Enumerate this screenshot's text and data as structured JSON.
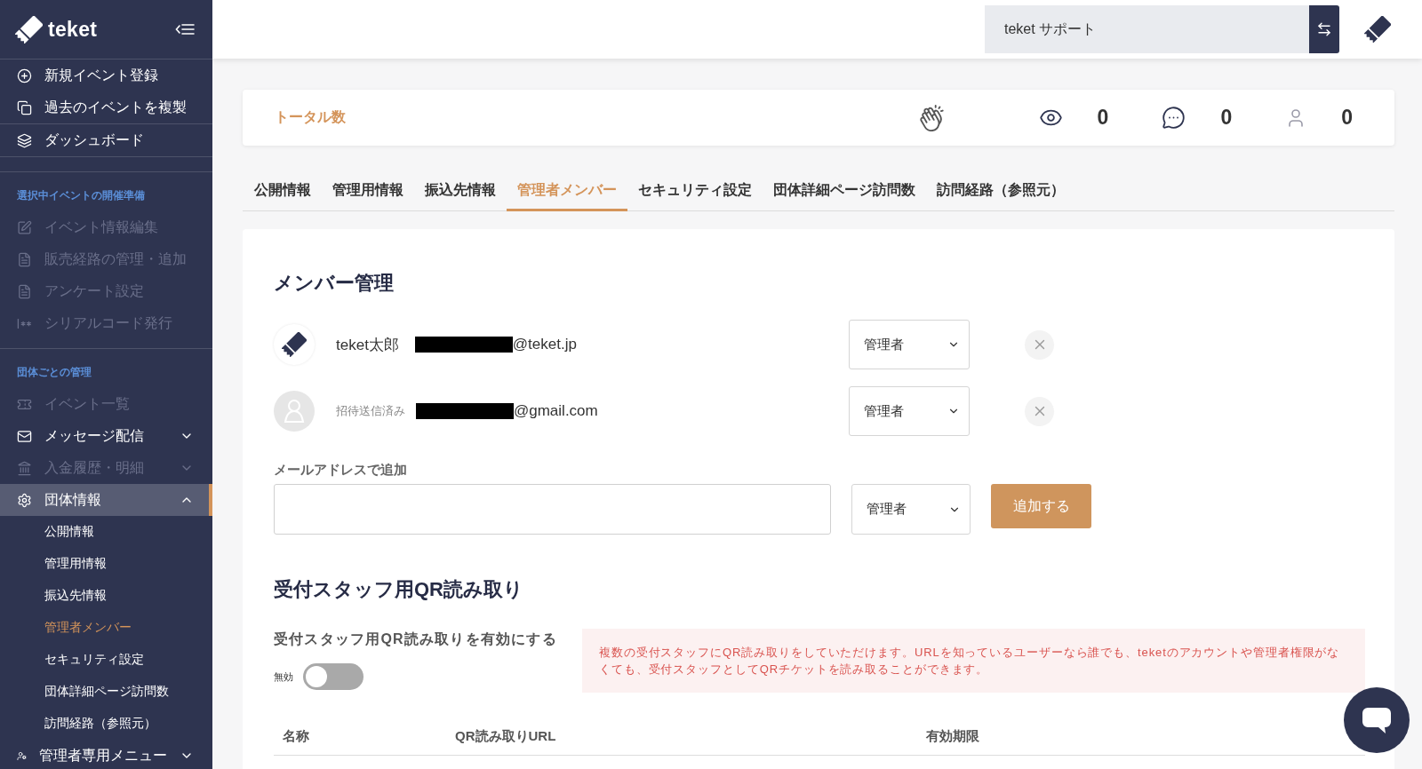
{
  "sidebar": {
    "brand": "teket",
    "groups": [
      {
        "items": [
          {
            "kind": "link",
            "label": "新規イベント登録",
            "selected": false,
            "disabled": false
          },
          {
            "kind": "link",
            "label": "過去のイベントを複製",
            "selected": false,
            "disabled": false
          }
        ]
      },
      {
        "items": [
          {
            "kind": "link",
            "label": "ダッシュボード",
            "selected": false,
            "disabled": false
          }
        ]
      },
      {
        "heading": "選択中イベントの開催準備",
        "items": [
          {
            "kind": "link",
            "label": "イベント情報編集",
            "selected": false,
            "disabled": true
          },
          {
            "kind": "link",
            "label": "販売経路の管理・追加",
            "selected": false,
            "disabled": true
          },
          {
            "kind": "link",
            "label": "アンケート設定",
            "selected": false,
            "disabled": true
          },
          {
            "kind": "link",
            "label": "シリアルコード発行",
            "selected": false,
            "disabled": true
          }
        ]
      },
      {
        "heading": "団体ごとの管理",
        "items": [
          {
            "kind": "link",
            "label": "イベント一覧",
            "selected": false,
            "disabled": true
          },
          {
            "kind": "menu",
            "label": "メッセージ配信",
            "selected": false,
            "disabled": false,
            "expanded": false
          },
          {
            "kind": "menu",
            "label": "入金履歴・明細",
            "selected": false,
            "disabled": true,
            "expanded": false
          },
          {
            "kind": "menu",
            "label": "団体情報",
            "selected": true,
            "disabled": false,
            "expanded": true,
            "children": [
              {
                "label": "公開情報",
                "selected": false
              },
              {
                "label": "管理用情報",
                "selected": false
              },
              {
                "label": "振込先情報",
                "selected": false
              },
              {
                "label": "管理者メンバー",
                "selected": true
              },
              {
                "label": "セキュリティ設定",
                "selected": false
              },
              {
                "label": "団体詳細ページ訪問数",
                "selected": false
              },
              {
                "label": "訪問経路（参照元）",
                "selected": false
              }
            ]
          },
          {
            "kind": "menu",
            "label": "管理者専用メニュー",
            "selected": false,
            "disabled": false,
            "expanded": false
          }
        ]
      }
    ]
  },
  "header": {
    "account": "teket サポート"
  },
  "totals": {
    "title": "トータル数",
    "stats": [
      {
        "value": "0"
      },
      {
        "value": "0"
      },
      {
        "value": "0"
      }
    ]
  },
  "tabs": [
    {
      "label": "公開情報",
      "selected": false
    },
    {
      "label": "管理用情報",
      "selected": false
    },
    {
      "label": "振込先情報",
      "selected": false
    },
    {
      "label": "管理者メンバー",
      "selected": true
    },
    {
      "label": "セキュリティ設定",
      "selected": false
    },
    {
      "label": "団体詳細ページ訪問数",
      "selected": false
    },
    {
      "label": "訪問経路（参照元）",
      "selected": false
    }
  ],
  "members": {
    "title": "メンバー管理",
    "rows": [
      {
        "kind": "account",
        "name": "teket太郎",
        "email_redacted": true,
        "email": "@teket.jp",
        "role": "管理者"
      },
      {
        "kind": "invited",
        "status": "招待送信済み",
        "email_redacted": true,
        "email": "@gmail.com",
        "role": "管理者"
      }
    ],
    "add": {
      "label": "メールアドレスで追加",
      "role": "管理者",
      "button": "追加する"
    }
  },
  "qr_reader": {
    "title": "受付スタッフ用QR読み取り",
    "toggle_label": "受付スタッフ用QR読み取りを有効にする",
    "state_text": "無効",
    "on": false,
    "notice": "複数の受付スタッフにQR読み取りをしていただけます。URLを知っているユーザーなら誰でも、teketのアカウントや管理者権限がなくても、受付スタッフとしてQRチケットを読み取ることができます。",
    "columns": [
      "名称",
      "QR読み取りURL",
      "有効期限"
    ]
  }
}
